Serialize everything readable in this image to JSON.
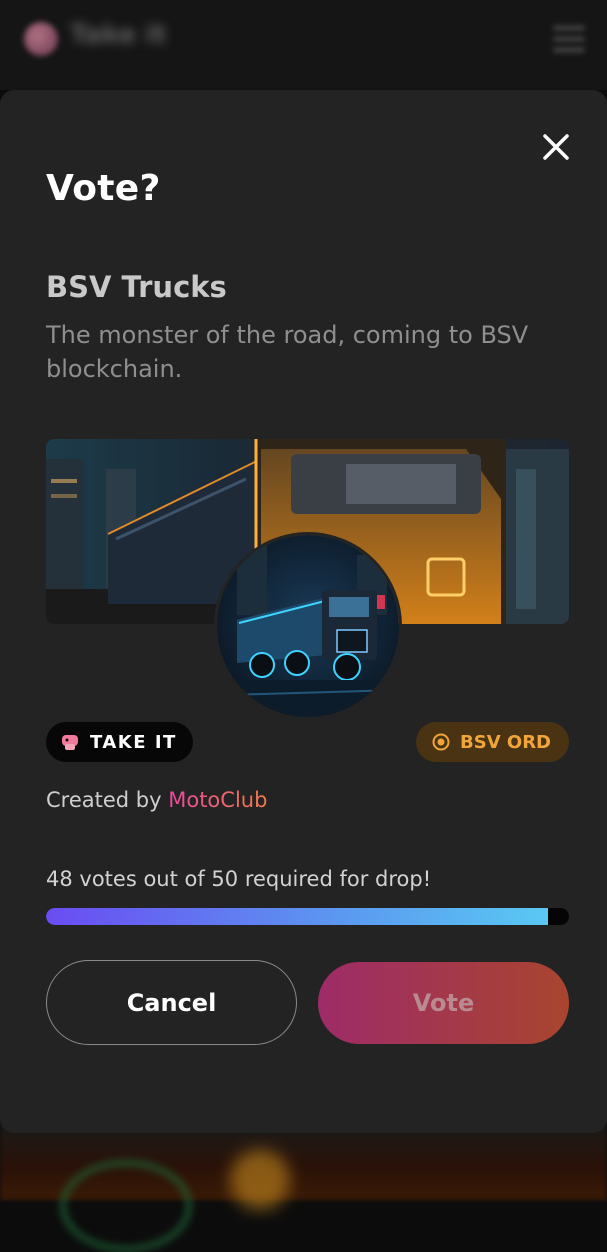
{
  "app": {
    "name": "Take it"
  },
  "modal": {
    "title": "Vote?",
    "project_name": "BSV Trucks",
    "description": "The monster of the road, coming to BSV blockchain.",
    "badges": {
      "platform_label": "TAKE IT",
      "chain_label": "BSV ORD"
    },
    "creator": {
      "prefix": "Created by",
      "name": "MotoClub"
    },
    "votes": {
      "text": "48 votes out of 50 required for drop!",
      "current": 48,
      "required": 50
    },
    "buttons": {
      "cancel": "Cancel",
      "vote": "Vote"
    }
  },
  "colors": {
    "modal_bg": "#232323",
    "chain_badge": "#f0a53a",
    "creator_link_start": "#e84a9d",
    "creator_link_end": "#f07a4a",
    "progress_start": "#6a4cf2",
    "progress_end": "#5ac8f3",
    "vote_button_start": "#9e2b68",
    "vote_button_end": "#a8452e"
  },
  "icons": {
    "close": "close-icon",
    "platform": "take-it-logo-icon",
    "chain": "bsv-ord-icon"
  }
}
